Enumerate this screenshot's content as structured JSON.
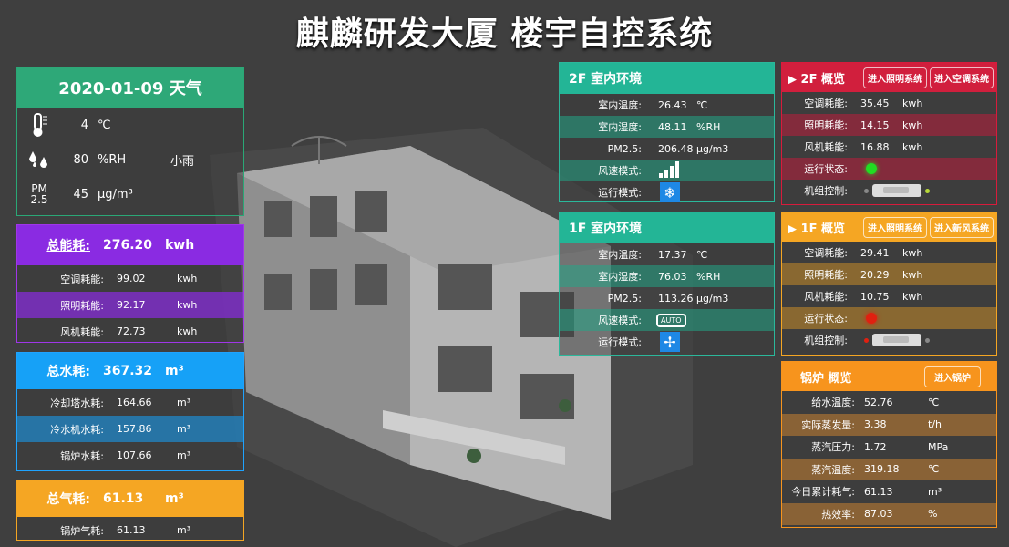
{
  "title": "麒麟研发大厦 楼宇自控系统",
  "weather": {
    "header": "2020-01-09 天气",
    "temp": "4",
    "temp_unit": "℃",
    "humidity": "80",
    "humidity_unit": "%RH",
    "condition": "小雨",
    "pm_label_top": "PM",
    "pm_label_bottom": "2.5",
    "pm": "45",
    "pm_unit": "μg/m³"
  },
  "energy": {
    "label": "总能耗:",
    "value": "276.20",
    "unit": "kwh",
    "rows": [
      {
        "k": "空调耗能:",
        "v": "99.02",
        "u": "kwh"
      },
      {
        "k": "照明耗能:",
        "v": "92.17",
        "u": "kwh"
      },
      {
        "k": "风机耗能:",
        "v": "72.73",
        "u": "kwh"
      }
    ]
  },
  "water": {
    "label": "总水耗:",
    "value": "367.32",
    "unit": "m³",
    "rows": [
      {
        "k": "冷却塔水耗:",
        "v": "164.66",
        "u": "m³"
      },
      {
        "k": "冷水机水耗:",
        "v": "157.86",
        "u": "m³"
      },
      {
        "k": "锅炉水耗:",
        "v": "107.66",
        "u": "m³"
      }
    ]
  },
  "gas": {
    "label": "总气耗:",
    "value": "61.13",
    "unit": "m³",
    "rows": [
      {
        "k": "锅炉气耗:",
        "v": "61.13",
        "u": "m³"
      }
    ]
  },
  "env2": {
    "title": "2F 室内环境",
    "rows": [
      {
        "k": "室内温度:",
        "v": "26.43",
        "u": "℃"
      },
      {
        "k": "室内湿度:",
        "v": "48.11",
        "u": "%RH"
      },
      {
        "k": "PM2.5:",
        "v": "206.48",
        "u": "μg/m3"
      }
    ],
    "fan_label": "风速模式:",
    "mode_label": "运行模式:"
  },
  "env1": {
    "title": "1F 室内环境",
    "rows": [
      {
        "k": "室内温度:",
        "v": "17.37",
        "u": "℃"
      },
      {
        "k": "室内湿度:",
        "v": "76.03",
        "u": "%RH"
      },
      {
        "k": "PM2.5:",
        "v": "113.26",
        "u": "μg/m3"
      }
    ],
    "fan_label": "风速模式:",
    "fan_value": "AUTO",
    "mode_label": "运行模式:"
  },
  "ov2": {
    "title": "2F 概览",
    "btn1": "进入照明系统",
    "btn2": "进入空调系统",
    "rows": [
      {
        "k": "空调耗能:",
        "v": "35.45",
        "u": "kwh"
      },
      {
        "k": "照明耗能:",
        "v": "14.15",
        "u": "kwh"
      },
      {
        "k": "风机耗能:",
        "v": "16.88",
        "u": "kwh"
      }
    ],
    "status_label": "运行状态:",
    "control_label": "机组控制:",
    "status_color": "#22dd22"
  },
  "ov1": {
    "title": "1F 概览",
    "btn1": "进入照明系统",
    "btn2": "进入新风系统",
    "rows": [
      {
        "k": "空调耗能:",
        "v": "29.41",
        "u": "kwh"
      },
      {
        "k": "照明耗能:",
        "v": "20.29",
        "u": "kwh"
      },
      {
        "k": "风机耗能:",
        "v": "10.75",
        "u": "kwh"
      }
    ],
    "status_label": "运行状态:",
    "control_label": "机组控制:",
    "status_color": "#e02010"
  },
  "boiler": {
    "title": "锅炉 概览",
    "btn": "进入锅炉",
    "rows": [
      {
        "k": "给水温度:",
        "v": "52.76",
        "u": "℃"
      },
      {
        "k": "实际蒸发量:",
        "v": "3.38",
        "u": "t/h"
      },
      {
        "k": "蒸汽压力:",
        "v": "1.72",
        "u": "MPa"
      },
      {
        "k": "蒸汽温度:",
        "v": "319.18",
        "u": "℃"
      },
      {
        "k": "今日累计耗气:",
        "v": "61.13",
        "u": "m³"
      },
      {
        "k": "热效率:",
        "v": "87.03",
        "u": "%"
      }
    ]
  }
}
